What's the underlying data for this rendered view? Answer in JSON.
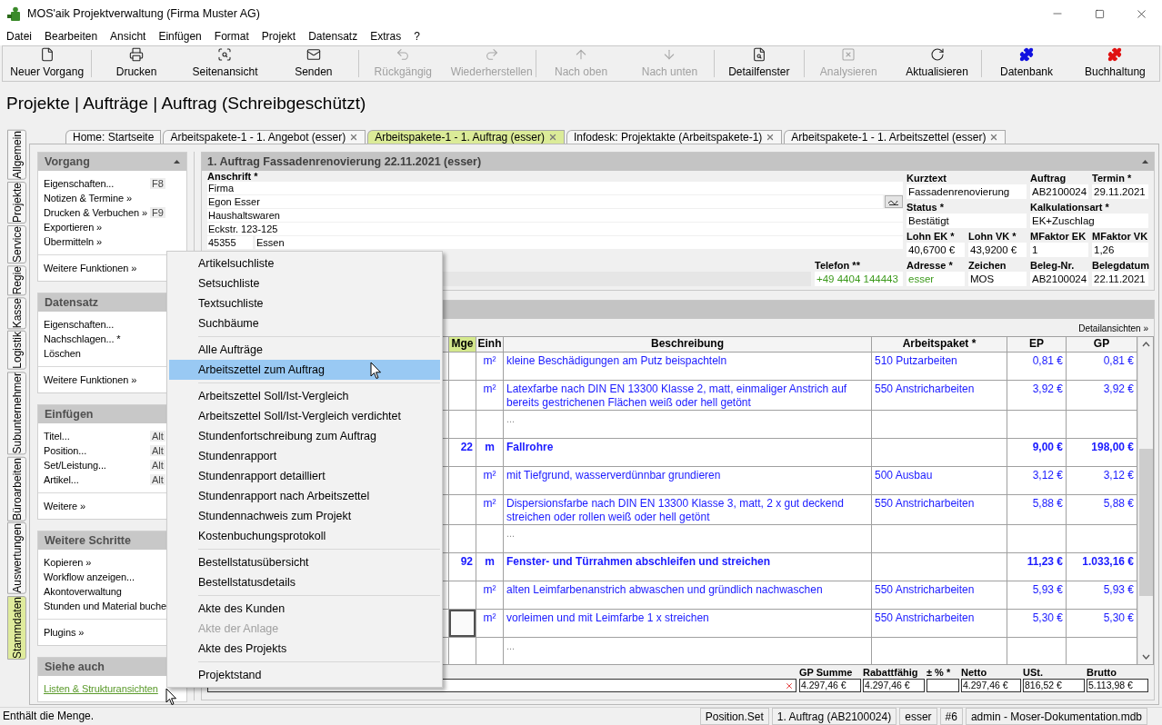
{
  "window": {
    "title": "MOS'aik Projektverwaltung (Firma Muster AG)"
  },
  "menu_bar": [
    "Datei",
    "Bearbeiten",
    "Ansicht",
    "Einfügen",
    "Format",
    "Projekt",
    "Datensatz",
    "Extras",
    "?"
  ],
  "toolbar": {
    "groups": [
      [
        {
          "label": "Neuer Vorgang",
          "disabled": false
        }
      ],
      [
        {
          "label": "Drucken",
          "disabled": false
        },
        {
          "label": "Seitenansicht",
          "disabled": false
        },
        {
          "label": "Senden",
          "disabled": false
        }
      ],
      [
        {
          "label": "Rückgängig",
          "disabled": true
        },
        {
          "label": "Wiederherstellen",
          "disabled": true
        }
      ],
      [
        {
          "label": "Nach oben",
          "disabled": true
        },
        {
          "label": "Nach unten",
          "disabled": true
        }
      ],
      [
        {
          "label": "Detailfenster",
          "disabled": false
        }
      ],
      [
        {
          "label": "Analysieren",
          "disabled": true
        },
        {
          "label": "Aktualisieren",
          "disabled": false
        }
      ],
      [
        {
          "label": "Datenbank",
          "disabled": false
        },
        {
          "label": "Buchhaltung",
          "disabled": false
        }
      ]
    ]
  },
  "heading": "Projekte | Aufträge | Auftrag (Schreibgeschützt)",
  "side_tabs": [
    {
      "label": "Allgemein",
      "selected": false
    },
    {
      "label": "Projekte",
      "selected": false
    },
    {
      "label": "Service",
      "selected": false
    },
    {
      "label": "Regie",
      "selected": false
    },
    {
      "label": "Kasse",
      "selected": false
    },
    {
      "label": "Logistik",
      "selected": false
    },
    {
      "label": "Subunternehmer",
      "selected": false
    },
    {
      "label": "Büroarbeiten",
      "selected": false
    },
    {
      "label": "Auswertungen",
      "selected": false
    },
    {
      "label": "Stammdaten",
      "selected": true
    }
  ],
  "doc_tabs": [
    {
      "label": "Home: Startseite",
      "selected": false,
      "closable": false
    },
    {
      "label": "Arbeitspakete-1 - 1. Angebot (esser)",
      "selected": false,
      "closable": true
    },
    {
      "label": "Arbeitspakete-1 - 1. Auftrag (esser)",
      "selected": true,
      "closable": true
    },
    {
      "label": "Infodesk: Projektakte (Arbeitspakete-1)",
      "selected": false,
      "closable": true
    },
    {
      "label": "Arbeitspakete-1 - 1. Arbeitszettel (esser)",
      "selected": false,
      "closable": true
    }
  ],
  "task_panel": {
    "sections": [
      {
        "title": "Vorgang",
        "collapsible": true,
        "groups": [
          [
            {
              "label": "Eigenschaften...",
              "shortcut": "F8",
              "kind": "action"
            },
            {
              "label": "Notizen & Termine »",
              "kind": "action"
            },
            {
              "label": "Drucken & Verbuchen »",
              "shortcut": "F9",
              "kind": "action"
            },
            {
              "label": "Exportieren »",
              "kind": "action"
            },
            {
              "label": "Übermitteln »",
              "kind": "action"
            }
          ],
          [
            {
              "label": "Weitere Funktionen »",
              "kind": "action"
            }
          ]
        ]
      },
      {
        "title": "Datensatz",
        "groups": [
          [
            {
              "label": "Eigenschaften...",
              "kind": "action"
            },
            {
              "label": "Nachschlagen... *",
              "kind": "action"
            },
            {
              "label": "Löschen",
              "kind": "action"
            }
          ],
          [
            {
              "label": "Weitere Funktionen »",
              "kind": "action"
            }
          ]
        ]
      },
      {
        "title": "Einfügen",
        "groups": [
          [
            {
              "label": "Titel...",
              "shortcut": "Alt",
              "kind": "action"
            },
            {
              "label": "Position...",
              "shortcut": "Alt",
              "kind": "action"
            },
            {
              "label": "Set/Leistung...",
              "shortcut": "Alt",
              "kind": "action"
            },
            {
              "label": "Artikel...",
              "shortcut": "Alt",
              "kind": "action"
            }
          ],
          [
            {
              "label": "Weitere »",
              "kind": "action"
            }
          ]
        ]
      },
      {
        "title": "Weitere Schritte",
        "groups": [
          [
            {
              "label": "Kopieren »",
              "kind": "action"
            },
            {
              "label": "Workflow anzeigen...",
              "kind": "action"
            },
            {
              "label": "Akontoverwaltung",
              "kind": "action"
            },
            {
              "label": "Stunden und Material buche",
              "kind": "action"
            }
          ],
          [
            {
              "label": "Plugins »",
              "kind": "action"
            }
          ]
        ]
      },
      {
        "title": "Siehe auch",
        "groups": [
          [
            {
              "label": "Listen & Strukturansichten",
              "kind": "link"
            }
          ]
        ]
      }
    ]
  },
  "order_panel": {
    "title": "1. Auftrag Fassadenrenovierung 22.11.2021 (esser)",
    "address": {
      "label": "Anschrift *",
      "lines": [
        "Firma",
        "Egon Esser",
        "Haushaltswaren",
        "Eckstr. 123-125"
      ],
      "zip": "45355",
      "city": "Essen"
    },
    "phone": {
      "label": "Telefon **",
      "value": "+49 4404 144443"
    },
    "fields": [
      {
        "label": "Kurztext",
        "value": "Fassadenrenovierung",
        "linked": false
      },
      {
        "label": "Auftrag",
        "value": "AB2100024",
        "linked": false
      },
      {
        "label": "Termin *",
        "value": "29.11.2021",
        "linked": false
      },
      {
        "label": "Status *",
        "value": "Bestätigt",
        "linked": false
      },
      {
        "label": "Kalkulationsart *",
        "value": "EK+Zuschlag",
        "linked": false
      },
      {
        "label": "Lohn EK *",
        "value": "40,6700 €",
        "linked": false
      },
      {
        "label": "Lohn VK *",
        "value": "43,9200 €",
        "linked": false
      },
      {
        "label": "MFaktor EK",
        "value": "1",
        "linked": false
      },
      {
        "label": "MFaktor VK",
        "value": "1,26",
        "linked": false
      },
      {
        "label": "Adresse *",
        "value": "esser",
        "linked": true
      },
      {
        "label": "Zeichen",
        "value": "MOS",
        "linked": false
      },
      {
        "label": "Beleg-Nr.",
        "value": "AB2100024",
        "linked": false
      },
      {
        "label": "Belegdatum",
        "value": "22.11.2021",
        "linked": false
      }
    ]
  },
  "positions_panel": {
    "link": "Detailansichten »",
    "columns": [
      {
        "label": "Mge",
        "selected": true
      },
      {
        "label": "Einh",
        "selected": false
      },
      {
        "label": "Beschreibung",
        "selected": false
      },
      {
        "label": "Arbeitspaket *",
        "selected": false
      },
      {
        "label": "EP",
        "selected": false
      },
      {
        "label": "GP",
        "selected": false
      }
    ],
    "rows": [
      {
        "kind": "item",
        "unit": "m²",
        "text": "kleine Beschädigungen am Putz beispachteln",
        "package": "510 Putzarbeiten",
        "ep": "0,81 €",
        "gp": "0,81 €",
        "focused": false
      },
      {
        "kind": "item",
        "unit": "m²",
        "text": "Latexfarbe nach DIN EN 13300 Klasse 2, matt, einmaliger Anstrich auf bereits gestrichenen Flächen weiß oder hell getönt",
        "package": "550 Anstricharbeiten",
        "ep": "3,92 €",
        "gp": "3,92 €",
        "focused": false
      },
      {
        "kind": "more",
        "text": "...",
        "focused": false
      },
      {
        "kind": "set",
        "qty": "22",
        "unit": "m",
        "text": "Fallrohre",
        "ep": "9,00 €",
        "gp": "198,00 €",
        "focused": false
      },
      {
        "kind": "item",
        "unit": "m²",
        "text": "mit Tiefgrund, wasserverdünnbar grundieren",
        "package": "500 Ausbau",
        "ep": "3,12 €",
        "gp": "3,12 €",
        "focused": false
      },
      {
        "kind": "item",
        "unit": "m²",
        "text": "Dispersionsfarbe nach DIN EN 13300 Klasse 3, matt, 2 x gut deckend streichen oder rollen weiß oder hell getönt",
        "package": "550 Anstricharbeiten",
        "ep": "5,88 €",
        "gp": "5,88 €",
        "focused": false
      },
      {
        "kind": "more",
        "text": "...",
        "focused": false
      },
      {
        "kind": "set",
        "qty": "92",
        "unit": "m",
        "text": "Fenster- und Türrahmen abschleifen und streichen",
        "ep": "11,23 €",
        "gp": "1.033,16 €",
        "focused": false
      },
      {
        "kind": "item",
        "unit": "m²",
        "text": "alten Leimfarbenanstrich abwaschen und gründlich nachwaschen",
        "package": "550 Anstricharbeiten",
        "ep": "5,93 €",
        "gp": "5,93 €",
        "focused": false
      },
      {
        "kind": "item",
        "unit": "m²",
        "text": "vorleimen und mit Leimfarbe 1 x streichen",
        "package": "550 Anstricharbeiten",
        "ep": "5,30 €",
        "gp": "5,30 €",
        "focused": true
      },
      {
        "kind": "more",
        "text": "...",
        "focused": false
      }
    ],
    "totals": [
      {
        "label": "GP Summe",
        "value": "4.297,46 €"
      },
      {
        "label": "Rabattfähig",
        "value": "4.297,46 €"
      },
      {
        "label": "± % *"
      },
      {
        "label": "Netto",
        "value": "4.297,46 €"
      },
      {
        "label": "USt.",
        "value": "816,52 €"
      },
      {
        "label": "Brutto",
        "value": "5.113,98 €"
      }
    ]
  },
  "context_menu": {
    "groups": [
      [
        {
          "label": "Artikelsuchliste",
          "selected": false,
          "disabled": false
        },
        {
          "label": "Setsuchliste",
          "selected": false,
          "disabled": false
        },
        {
          "label": "Textsuchliste",
          "selected": false,
          "disabled": false
        },
        {
          "label": "Suchbäume",
          "selected": false,
          "disabled": false
        }
      ],
      [
        {
          "label": "Alle Aufträge",
          "selected": false,
          "disabled": false
        },
        {
          "label": "Arbeitszettel zum Auftrag",
          "selected": true,
          "disabled": false
        }
      ],
      [
        {
          "label": "Arbeitszettel Soll/Ist-Vergleich",
          "selected": false,
          "disabled": false
        },
        {
          "label": "Arbeitszettel Soll/Ist-Vergleich verdichtet",
          "selected": false,
          "disabled": false
        },
        {
          "label": "Stundenfortschreibung zum Auftrag",
          "selected": false,
          "disabled": false
        },
        {
          "label": "Stundenrapport",
          "selected": false,
          "disabled": false
        },
        {
          "label": "Stundenrapport detailliert",
          "selected": false,
          "disabled": false
        },
        {
          "label": "Stundenrapport nach Arbeitszettel",
          "selected": false,
          "disabled": false
        },
        {
          "label": "Stundennachweis zum Projekt",
          "selected": false,
          "disabled": false
        },
        {
          "label": "Kostenbuchungsprotokoll",
          "selected": false,
          "disabled": false
        }
      ],
      [
        {
          "label": "Bestellstatusübersicht",
          "selected": false,
          "disabled": false
        },
        {
          "label": "Bestellstatusdetails",
          "selected": false,
          "disabled": false
        }
      ],
      [
        {
          "label": "Akte des Kunden",
          "selected": false,
          "disabled": false
        },
        {
          "label": "Akte der Anlage",
          "selected": false,
          "disabled": true
        },
        {
          "label": "Akte des Projekts",
          "selected": false,
          "disabled": false
        }
      ],
      [
        {
          "label": "Projektstand",
          "selected": false,
          "disabled": false
        }
      ]
    ]
  },
  "status_bar": {
    "message": "Enthält die Menge.",
    "panes": [
      "Position.Set",
      "1. Auftrag (AB2100024)",
      "esser",
      "#6",
      "admin - Moser-Dokumentation.mdb"
    ]
  }
}
